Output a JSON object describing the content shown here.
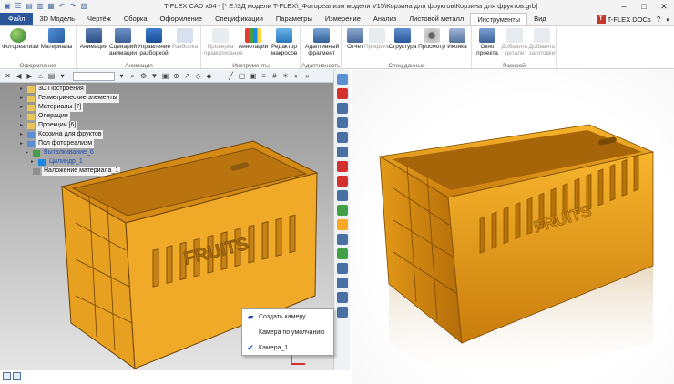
{
  "window": {
    "title": "T-FLEX CAD x64 - [* E:\\3Д модели T-FLEX\\_Фотореализм модели V15\\Корзина для фруктов\\Корзина для фруктов.grb]",
    "brand": "T-FLEX DOCs",
    "controls": [
      "–",
      "□",
      "✕"
    ]
  },
  "tabs": [
    {
      "label": "Файл",
      "kind": "file"
    },
    {
      "label": "3D Модель"
    },
    {
      "label": "Чертёж"
    },
    {
      "label": "Сборка"
    },
    {
      "label": "Оформление"
    },
    {
      "label": "Спецификации"
    },
    {
      "label": "Параметры"
    },
    {
      "label": "Измерение"
    },
    {
      "label": "Анализ"
    },
    {
      "label": "Листовой металл"
    },
    {
      "label": "Инструменты",
      "active": true
    },
    {
      "label": "Вид"
    }
  ],
  "ribbon": {
    "groups": [
      {
        "label": "Оформление",
        "buttons": [
          "Фотореализм",
          "Материалы"
        ]
      },
      {
        "label": "Анимация",
        "buttons": [
          "Анимация",
          "Сценарий анимации",
          "Управление разборкой",
          "Разборка"
        ]
      },
      {
        "label": "Инструменты",
        "buttons": [
          "Проверка правописания",
          "Аннотации",
          "Редактор макросов"
        ]
      },
      {
        "label": "Адаптивность",
        "buttons": [
          "Адаптивный фрагмент"
        ]
      },
      {
        "label": "Спец.данные",
        "buttons": [
          "Отчет",
          "Профиль",
          "Структура",
          "Просмотр",
          "Иконка"
        ]
      },
      {
        "label": "Раскрой",
        "buttons": [
          "Окно проекта",
          "Добавить детали",
          "Добавить заготовки"
        ]
      }
    ]
  },
  "tree": [
    {
      "label": "3D Построения",
      "icon": "folder-icon"
    },
    {
      "label": "Геометрические элементы",
      "icon": "folder-icon"
    },
    {
      "label": "Материалы [7]",
      "icon": "folder-icon"
    },
    {
      "label": "Операции",
      "icon": "folder-icon"
    },
    {
      "label": "Проекции [6]",
      "icon": "folder-icon"
    },
    {
      "label": "Корзина для фруктов",
      "icon": "part-icon"
    },
    {
      "label": "Пол фотореализм",
      "icon": "part-icon"
    },
    {
      "label": "Выталкивание_6",
      "icon": "operation-icon"
    },
    {
      "label": "Цилиндр_1",
      "icon": "operation-icon"
    },
    {
      "label": "Наложение материала_1",
      "icon": "material-icon"
    }
  ],
  "popup": {
    "items": [
      {
        "label": "Создать камеру",
        "icon": "camera-icon"
      },
      {
        "label": "Камера по умолчанию",
        "icon": ""
      },
      {
        "label": "Камера_1",
        "icon": "check-icon",
        "checked": true
      }
    ]
  },
  "model": {
    "text": "FRUITS",
    "color": "#e8a020"
  }
}
